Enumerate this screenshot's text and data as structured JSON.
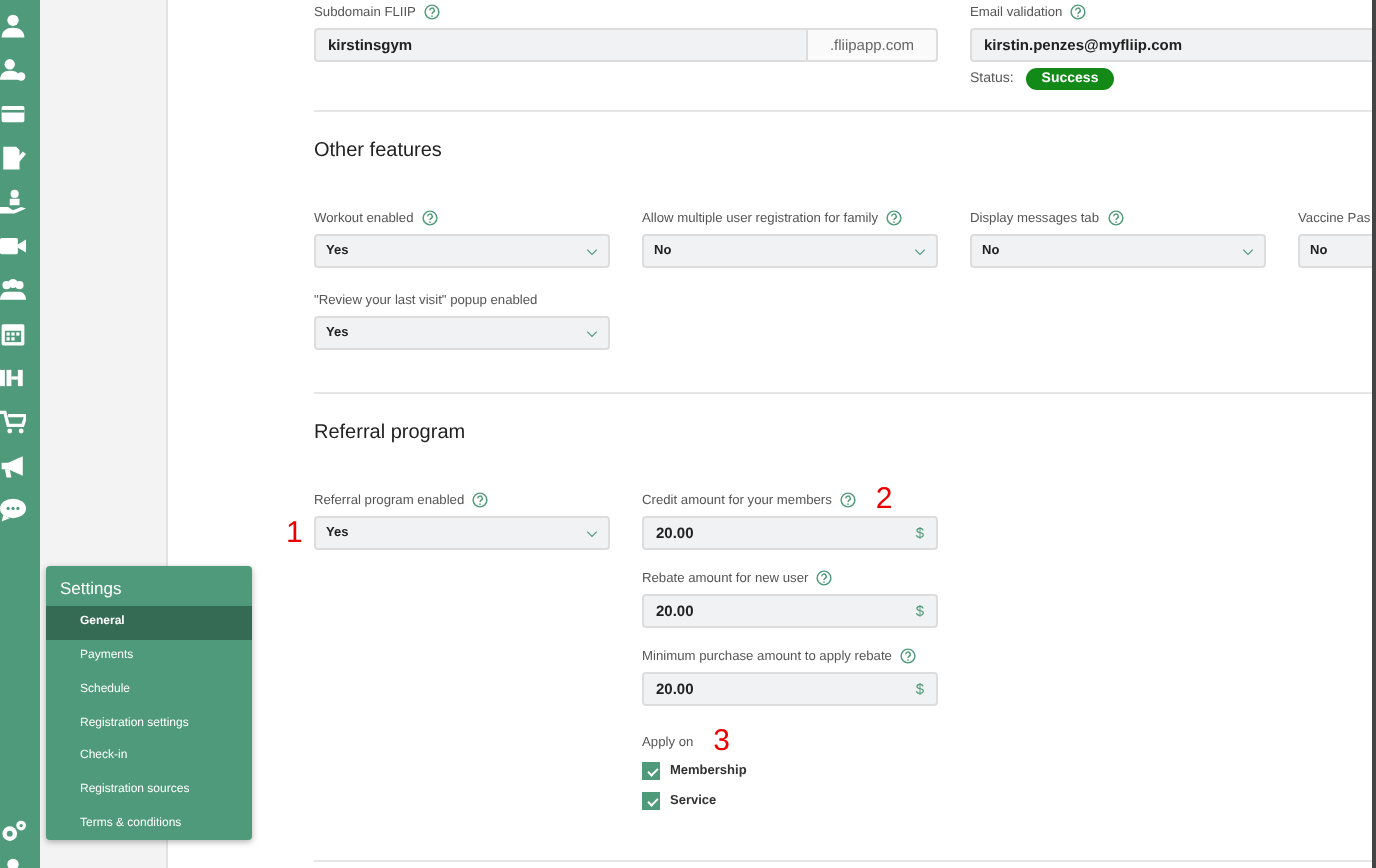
{
  "account": {
    "subdomain": {
      "label": "Subdomain FLIIP",
      "value": "kirstinsgym",
      "suffix": ".fliipapp.com"
    },
    "email": {
      "label": "Email validation",
      "value": "kirstin.penzes@myfliip.com",
      "status_label": "Status:",
      "status": "Success"
    }
  },
  "other_features": {
    "title": "Other features",
    "fields": [
      {
        "label": "Workout enabled",
        "help": true,
        "value": "Yes"
      },
      {
        "label": "Allow multiple user registration for family",
        "help": true,
        "value": "No"
      },
      {
        "label": "Display messages tab",
        "help": true,
        "value": "No"
      },
      {
        "label": "Vaccine Pas",
        "help": false,
        "value": "No"
      },
      {
        "label": "\"Review your last visit\" popup enabled",
        "help": false,
        "value": "Yes"
      }
    ]
  },
  "referral": {
    "title": "Referral program",
    "enabled": {
      "label": "Referral program enabled",
      "value": "Yes",
      "annotation": "1"
    },
    "amounts": [
      {
        "label": "Credit amount for your members",
        "value": "20.00",
        "unit": "$",
        "annotation": "2"
      },
      {
        "label": "Rebate amount for new user",
        "value": "20.00",
        "unit": "$"
      },
      {
        "label": "Minimum purchase amount to apply rebate",
        "value": "20.00",
        "unit": "$"
      }
    ],
    "apply_on": {
      "label": "Apply on",
      "annotation": "3",
      "options": [
        {
          "label": "Membership",
          "checked": true
        },
        {
          "label": "Service",
          "checked": true
        }
      ]
    }
  },
  "settings_menu": {
    "title": "Settings",
    "items": [
      {
        "label": "General",
        "selected": true
      },
      {
        "label": "Payments",
        "selected": false
      },
      {
        "label": "Schedule",
        "selected": false
      },
      {
        "label": "Registration settings",
        "selected": false
      },
      {
        "label": "Check-in",
        "selected": false
      },
      {
        "label": "Registration sources",
        "selected": false
      },
      {
        "label": "Terms & conditions",
        "selected": false
      }
    ]
  }
}
